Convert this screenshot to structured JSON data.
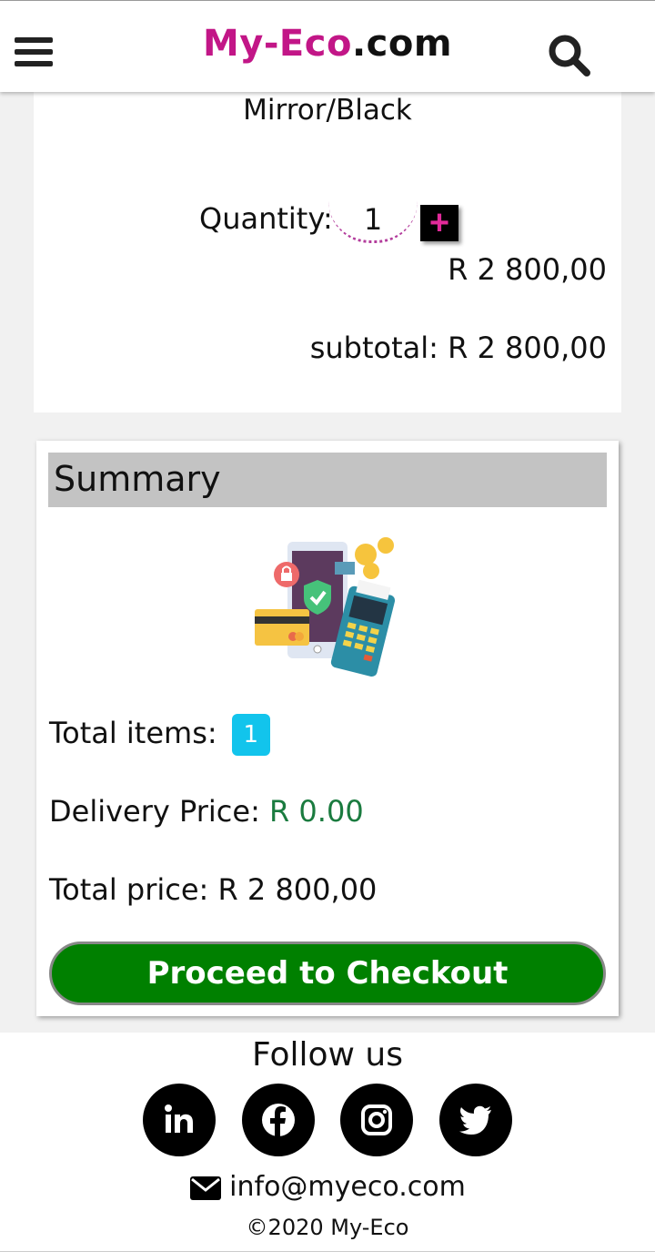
{
  "header": {
    "brand": "My-Eco",
    "tld": ".com",
    "menu_icon": "hamburger-menu-icon",
    "search_icon": "search-icon",
    "brand_color": "#c21687"
  },
  "cart_item": {
    "variant": "Mirror/Black",
    "quantity_label": "Quantity:",
    "quantity": "1",
    "plus_label": "+",
    "price": "R 2 800,00",
    "subtotal": "subtotal: R 2 800,00"
  },
  "summary": {
    "title": "Summary",
    "illustration": "mobile-payment-illustration",
    "total_items_label": "Total items:",
    "total_items": "1",
    "delivery_label": "Delivery Price:",
    "delivery_price": "R 0.00",
    "total_label": "Total price:",
    "total_price": "R 2 800,00",
    "checkout_label": "Proceed to Checkout",
    "checkout_color": "#008000"
  },
  "footer": {
    "follow": "Follow us",
    "socials": [
      "linkedin-icon",
      "facebook-icon",
      "instagram-icon",
      "twitter-icon"
    ],
    "email": "info@myeco.com",
    "copyright": "©2020 My-Eco"
  }
}
